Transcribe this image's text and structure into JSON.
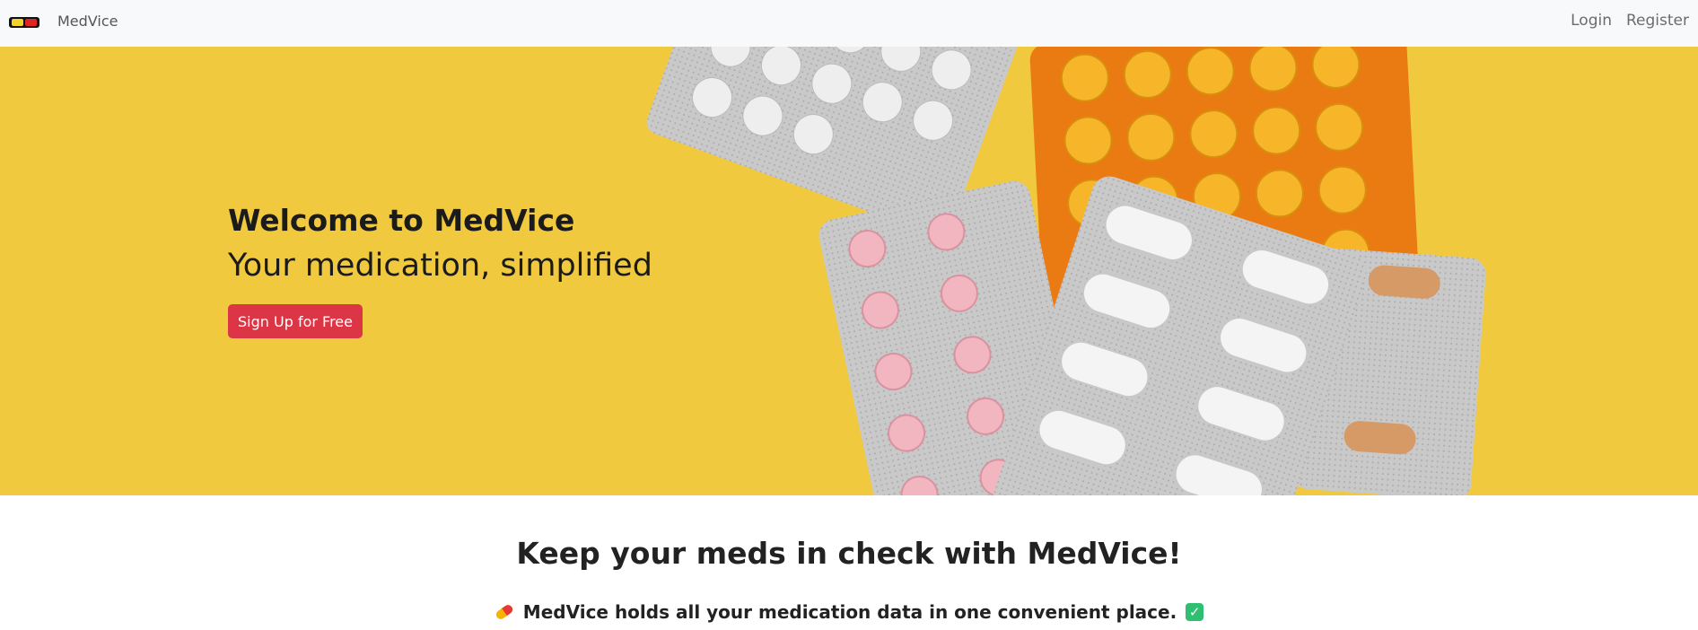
{
  "brand": {
    "name": "MedVice",
    "logo_icon": "pill-logo-icon"
  },
  "nav": {
    "login_label": "Login",
    "register_label": "Register"
  },
  "hero": {
    "title": "Welcome to MedVice",
    "subtitle": "Your medication, simplified",
    "cta_label": "Sign Up for Free",
    "background_color": "#f0c93f",
    "cta_color": "#dc3545"
  },
  "intro": {
    "title": "Keep your meds in check with MedVice!",
    "feature_text": "MedVice holds all your medication data in one convenient place.",
    "lead_icon": "pill-icon",
    "trail_icon": "check-icon"
  }
}
